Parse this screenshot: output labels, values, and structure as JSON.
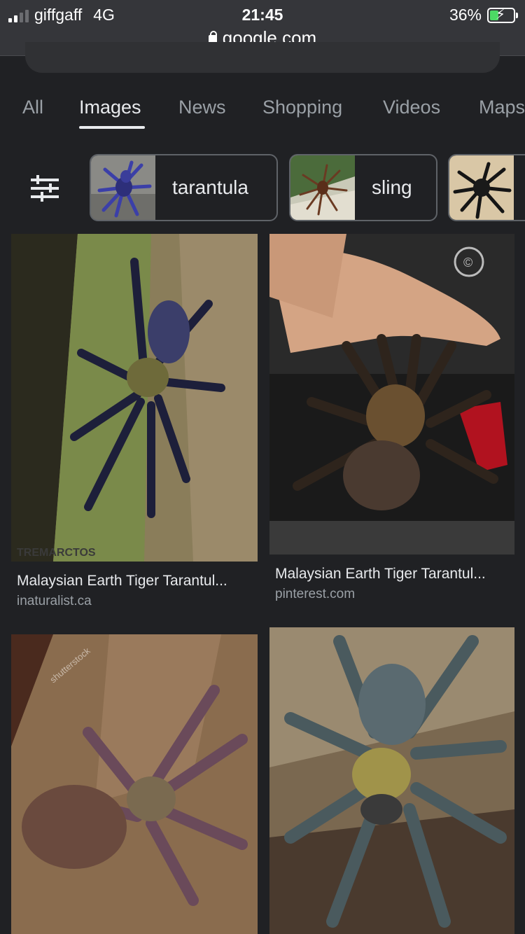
{
  "status_bar": {
    "carrier": "giffgaff",
    "network": "4G",
    "time": "21:45",
    "battery_percent": "36%",
    "url": "google.com"
  },
  "tabs": [
    {
      "label": "All",
      "active": false
    },
    {
      "label": "Images",
      "active": true
    },
    {
      "label": "News",
      "active": false
    },
    {
      "label": "Shopping",
      "active": false
    },
    {
      "label": "Videos",
      "active": false
    },
    {
      "label": "Maps",
      "active": false
    }
  ],
  "chips": [
    {
      "label": "tarantula"
    },
    {
      "label": "sling"
    },
    {
      "label": ""
    }
  ],
  "results": [
    {
      "title": "Malaysian Earth Tiger Tarantul...",
      "source": "inaturalist.ca",
      "watermark": "TREMARCTOS PHOTOGRAPHY"
    },
    {
      "title": "Malaysian Earth Tiger Tarantul...",
      "source": "pinterest.com",
      "watermark": "©"
    },
    {
      "title": "",
      "source": "",
      "watermark": "shutterstock"
    },
    {
      "title": "",
      "source": "",
      "watermark": ""
    }
  ],
  "colors": {
    "background": "#202124",
    "status_bar": "#35363a",
    "text_primary": "#e8eaed",
    "text_secondary": "#9aa0a6",
    "battery_fill": "#4cd964"
  },
  "icons": [
    "signal-icon",
    "lock-icon",
    "battery-icon",
    "filter-sliders-icon"
  ]
}
